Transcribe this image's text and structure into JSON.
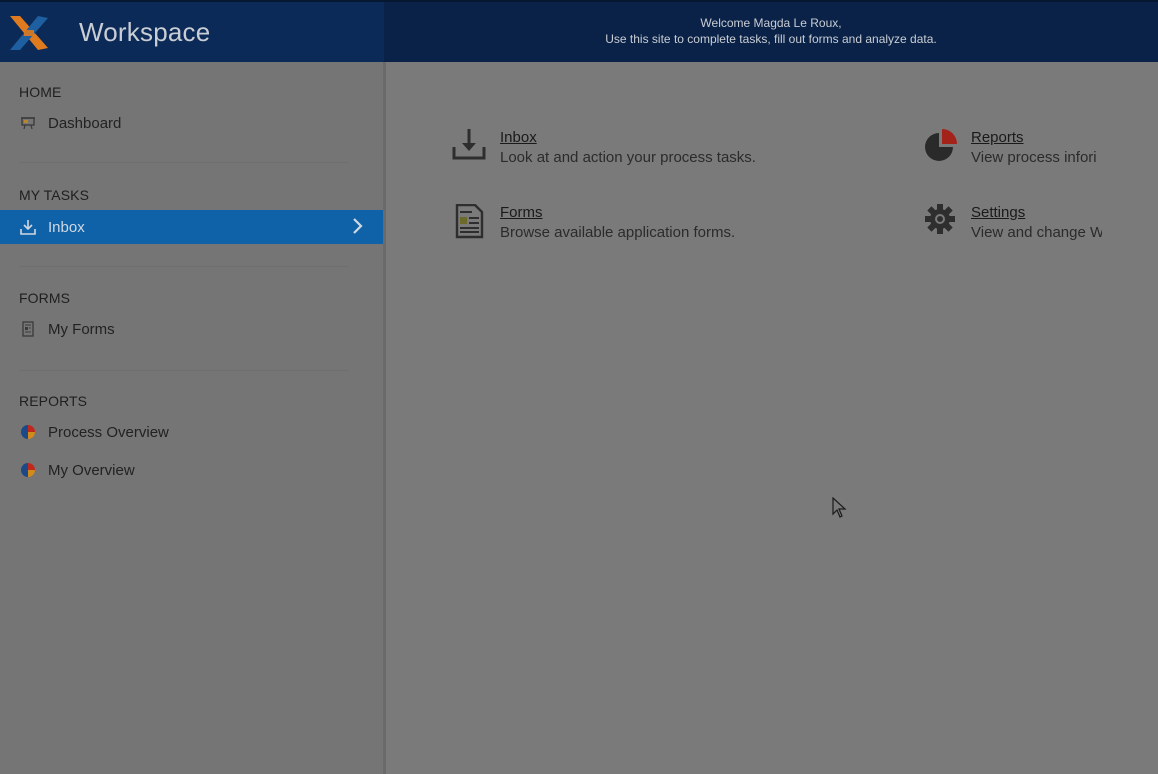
{
  "header": {
    "app_title": "Workspace",
    "welcome_line1": "Welcome Magda Le Roux,",
    "welcome_line2": "Use this site to complete tasks, fill out forms and analyze data."
  },
  "sidebar": {
    "sections": [
      {
        "title": "HOME",
        "items": [
          {
            "label": "Dashboard",
            "icon": "dashboard-icon"
          }
        ]
      },
      {
        "title": "MY TASKS",
        "items": [
          {
            "label": "Inbox",
            "icon": "inbox-icon",
            "active": true
          }
        ]
      },
      {
        "title": "FORMS",
        "items": [
          {
            "label": "My Forms",
            "icon": "form-icon"
          }
        ]
      },
      {
        "title": "REPORTS",
        "items": [
          {
            "label": "Process Overview",
            "icon": "pie-chart-icon"
          },
          {
            "label": "My Overview",
            "icon": "pie-chart-icon"
          }
        ]
      }
    ]
  },
  "main": {
    "tiles": [
      {
        "title": "Inbox",
        "description": "Look at and action your process tasks.",
        "icon": "inbox-download-icon"
      },
      {
        "title": "Reports",
        "description": "View process infori",
        "icon": "pie-chart-icon"
      },
      {
        "title": "Forms",
        "description": "Browse available application forms.",
        "icon": "form-document-icon"
      },
      {
        "title": "Settings",
        "description": "View and change W",
        "icon": "gear-icon"
      }
    ]
  },
  "colors": {
    "header_bg": "#0a2247",
    "active_item": "#1062a8",
    "logo_orange": "#e07a1f",
    "logo_blue": "#1d5fa0",
    "pie_red": "#c0281c"
  }
}
